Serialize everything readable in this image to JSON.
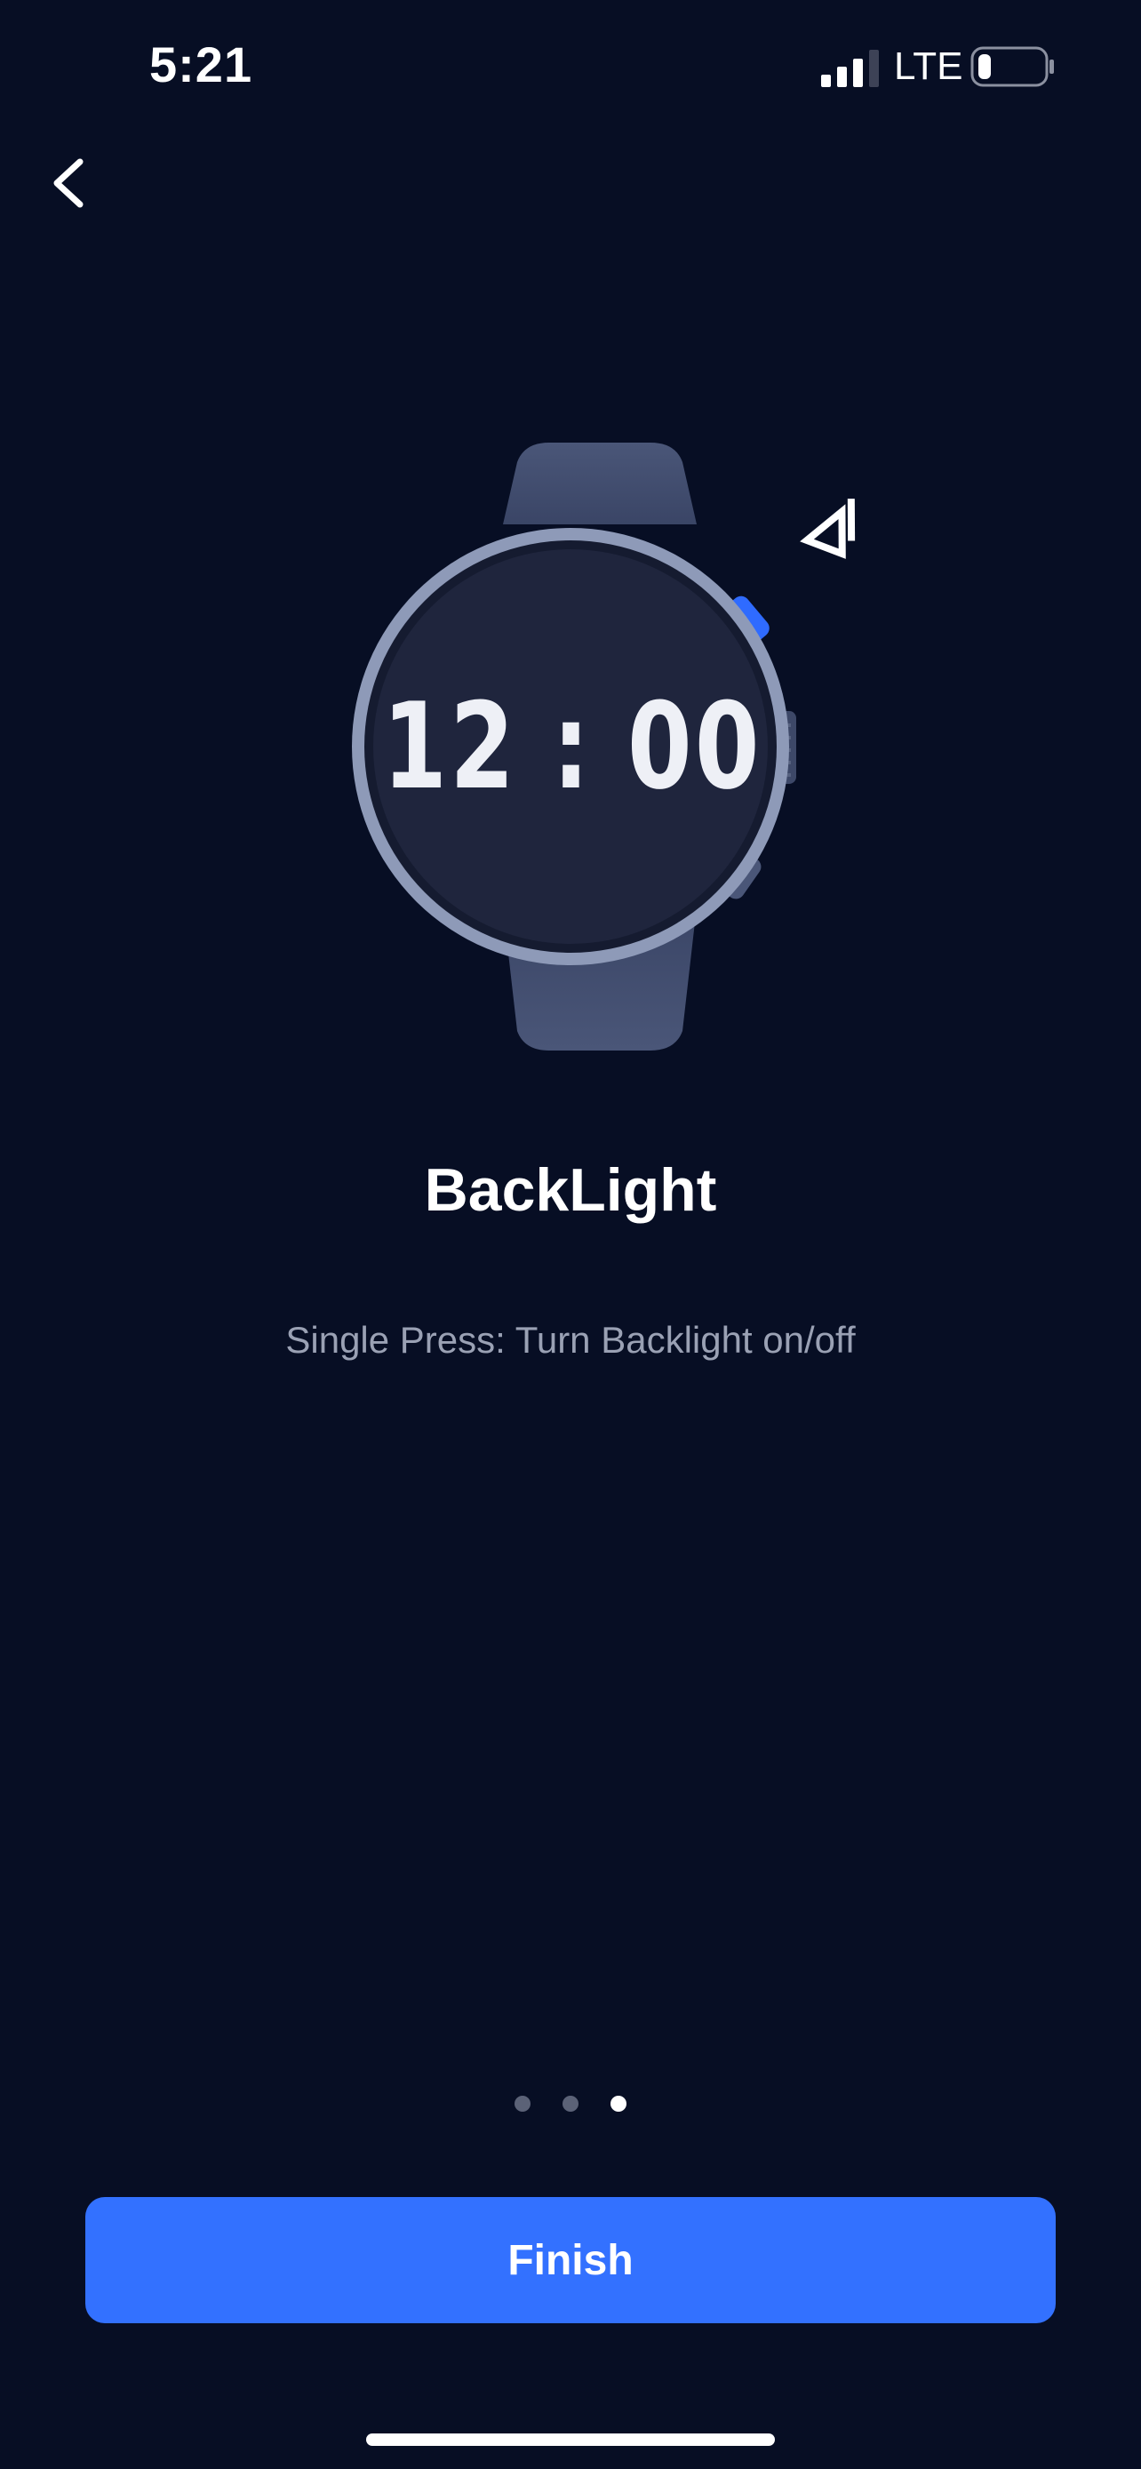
{
  "status_bar": {
    "time": "5:21",
    "network": "LTE",
    "battery_level": 0.2
  },
  "nav": {
    "back_icon": "chevron-left-icon"
  },
  "illustration": {
    "watch_time": "12 : 00",
    "highlight_button_color": "#2f6bff",
    "press_indicator_icon": "press-arrow-icon"
  },
  "content": {
    "title": "BackLight",
    "description": "Single Press: Turn Backlight on/off"
  },
  "pagination": {
    "total": 3,
    "active_index": 2
  },
  "actions": {
    "finish_label": "Finish"
  },
  "colors": {
    "background": "#070e24",
    "accent": "#3371ff",
    "text_secondary": "#9aa1b4"
  }
}
